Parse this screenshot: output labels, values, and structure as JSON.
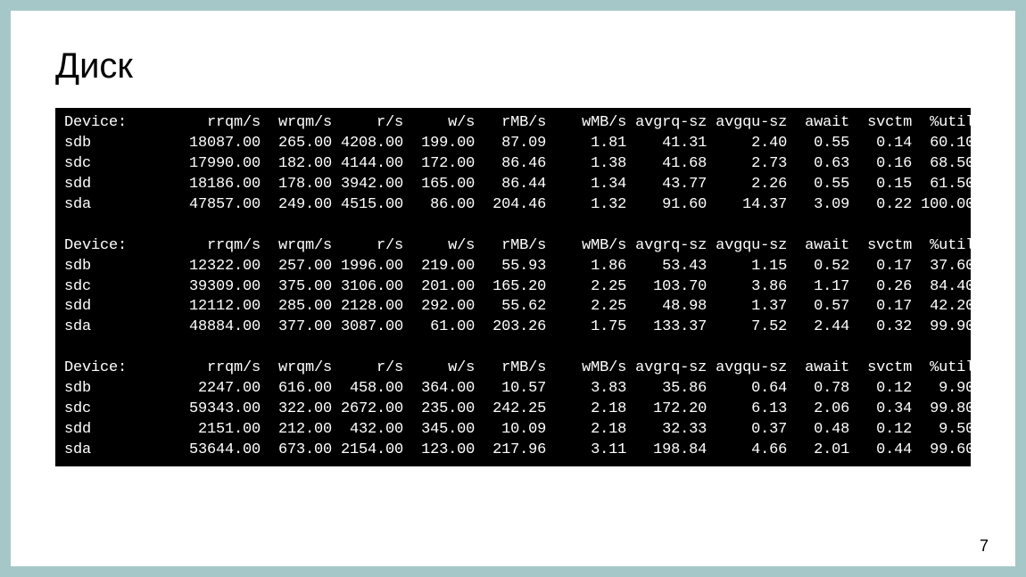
{
  "slide": {
    "title": "Диск",
    "page_number": "7"
  },
  "iostat": {
    "headers": [
      "Device:",
      "rrqm/s",
      "wrqm/s",
      "r/s",
      "w/s",
      "rMB/s",
      "wMB/s",
      "avgrq-sz",
      "avgqu-sz",
      "await",
      "svctm",
      "%util"
    ],
    "blocks": [
      [
        {
          "device": "sdb",
          "rrqm": "18087.00",
          "wrqm": "265.00",
          "rs": "4208.00",
          "ws": "199.00",
          "rmb": "87.09",
          "wmb": "1.81",
          "avgrq": "41.31",
          "avgqu": "2.40",
          "await": "0.55",
          "svctm": "0.14",
          "util": "60.10"
        },
        {
          "device": "sdc",
          "rrqm": "17990.00",
          "wrqm": "182.00",
          "rs": "4144.00",
          "ws": "172.00",
          "rmb": "86.46",
          "wmb": "1.38",
          "avgrq": "41.68",
          "avgqu": "2.73",
          "await": "0.63",
          "svctm": "0.16",
          "util": "68.50"
        },
        {
          "device": "sdd",
          "rrqm": "18186.00",
          "wrqm": "178.00",
          "rs": "3942.00",
          "ws": "165.00",
          "rmb": "86.44",
          "wmb": "1.34",
          "avgrq": "43.77",
          "avgqu": "2.26",
          "await": "0.55",
          "svctm": "0.15",
          "util": "61.50"
        },
        {
          "device": "sda",
          "rrqm": "47857.00",
          "wrqm": "249.00",
          "rs": "4515.00",
          "ws": "86.00",
          "rmb": "204.46",
          "wmb": "1.32",
          "avgrq": "91.60",
          "avgqu": "14.37",
          "await": "3.09",
          "svctm": "0.22",
          "util": "100.00"
        }
      ],
      [
        {
          "device": "sdb",
          "rrqm": "12322.00",
          "wrqm": "257.00",
          "rs": "1996.00",
          "ws": "219.00",
          "rmb": "55.93",
          "wmb": "1.86",
          "avgrq": "53.43",
          "avgqu": "1.15",
          "await": "0.52",
          "svctm": "0.17",
          "util": "37.60"
        },
        {
          "device": "sdc",
          "rrqm": "39309.00",
          "wrqm": "375.00",
          "rs": "3106.00",
          "ws": "201.00",
          "rmb": "165.20",
          "wmb": "2.25",
          "avgrq": "103.70",
          "avgqu": "3.86",
          "await": "1.17",
          "svctm": "0.26",
          "util": "84.40"
        },
        {
          "device": "sdd",
          "rrqm": "12112.00",
          "wrqm": "285.00",
          "rs": "2128.00",
          "ws": "292.00",
          "rmb": "55.62",
          "wmb": "2.25",
          "avgrq": "48.98",
          "avgqu": "1.37",
          "await": "0.57",
          "svctm": "0.17",
          "util": "42.20"
        },
        {
          "device": "sda",
          "rrqm": "48884.00",
          "wrqm": "377.00",
          "rs": "3087.00",
          "ws": "61.00",
          "rmb": "203.26",
          "wmb": "1.75",
          "avgrq": "133.37",
          "avgqu": "7.52",
          "await": "2.44",
          "svctm": "0.32",
          "util": "99.90"
        }
      ],
      [
        {
          "device": "sdb",
          "rrqm": "2247.00",
          "wrqm": "616.00",
          "rs": "458.00",
          "ws": "364.00",
          "rmb": "10.57",
          "wmb": "3.83",
          "avgrq": "35.86",
          "avgqu": "0.64",
          "await": "0.78",
          "svctm": "0.12",
          "util": "9.90"
        },
        {
          "device": "sdc",
          "rrqm": "59343.00",
          "wrqm": "322.00",
          "rs": "2672.00",
          "ws": "235.00",
          "rmb": "242.25",
          "wmb": "2.18",
          "avgrq": "172.20",
          "avgqu": "6.13",
          "await": "2.06",
          "svctm": "0.34",
          "util": "99.80"
        },
        {
          "device": "sdd",
          "rrqm": "2151.00",
          "wrqm": "212.00",
          "rs": "432.00",
          "ws": "345.00",
          "rmb": "10.09",
          "wmb": "2.18",
          "avgrq": "32.33",
          "avgqu": "0.37",
          "await": "0.48",
          "svctm": "0.12",
          "util": "9.50"
        },
        {
          "device": "sda",
          "rrqm": "53644.00",
          "wrqm": "673.00",
          "rs": "2154.00",
          "ws": "123.00",
          "rmb": "217.96",
          "wmb": "3.11",
          "avgrq": "198.84",
          "avgqu": "4.66",
          "await": "2.01",
          "svctm": "0.44",
          "util": "99.60"
        }
      ]
    ]
  },
  "column_widths": {
    "device": 12,
    "rrqm": 10,
    "wrqm": 8,
    "rs": 8,
    "ws": 8,
    "rmb": 8,
    "wmb": 9,
    "avgrq": 9,
    "avgqu": 9,
    "await": 7,
    "svctm": 7,
    "util": 7
  }
}
